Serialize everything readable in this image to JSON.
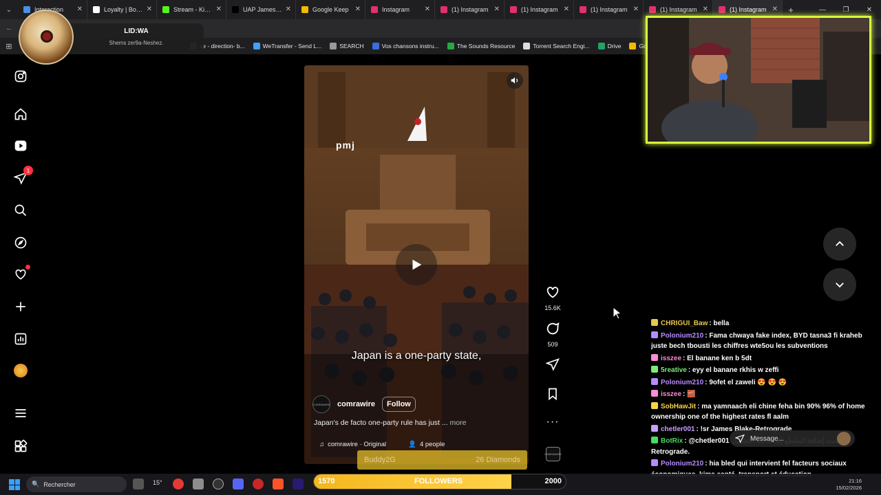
{
  "browser": {
    "tabs": [
      {
        "title": "Interaction",
        "color": "#4a90e2",
        "active": false
      },
      {
        "title": "Loyalty | BotRix",
        "color": "#ffffff",
        "active": false
      },
      {
        "title": "Stream - Kick D",
        "color": "#53fc18",
        "active": false
      },
      {
        "title": "UAP James on",
        "color": "#000000",
        "active": false
      },
      {
        "title": "Google Keep",
        "color": "#f6b900",
        "active": false
      },
      {
        "title": "Instagram",
        "color": "#e1306c",
        "active": false
      },
      {
        "title": "(1) Instagram",
        "color": "#e1306c",
        "active": false
      },
      {
        "title": "(1) Instagram",
        "color": "#e1306c",
        "active": false
      },
      {
        "title": "(1) Instagram",
        "color": "#e1306c",
        "active": false
      },
      {
        "title": "(1) Instagram",
        "color": "#e1306c",
        "active": false
      },
      {
        "title": "(1) Instagram",
        "color": "#e1306c",
        "active": true
      }
    ],
    "bookmarks": [
      {
        "label": "se - direction- b...",
        "color": "#777777"
      },
      {
        "label": "WeTransfer - Send L...",
        "color": "#409fff"
      },
      {
        "label": "SEARCH",
        "color": "#999999"
      },
      {
        "label": "Vos chansons instru...",
        "color": "#3b6edc"
      },
      {
        "label": "The Sounds Resource",
        "color": "#27a844"
      },
      {
        "label": "Torrent Search Engi...",
        "color": "#dddddd"
      },
      {
        "label": "Drive",
        "color": "#1fa463"
      },
      {
        "label": "Google Keep",
        "color": "#f6b900"
      }
    ]
  },
  "overlay": {
    "profile_name": "LID:WA",
    "profile_song": "Shems zer9a-Neshez."
  },
  "sidebar": {
    "notifications_badge": "1"
  },
  "reel": {
    "watermark": "pmj",
    "caption": "Japan is a one-party state,",
    "author": "comrawire",
    "author_avatar_text": "COMRAWIRE",
    "follow_label": "Follow",
    "description": "Japan's de facto one-party rule has just ...",
    "more_label": "more",
    "audio": "comrawire · Original",
    "people": "4 people",
    "likes": "15.6K",
    "comments": "509"
  },
  "chat": {
    "messages": [
      {
        "user": "CHRIGUI_Baw",
        "color": "#e6c84b",
        "text": ": bella"
      },
      {
        "user": "Polonium210",
        "color": "#b58cff",
        "text": ": Fama chwaya fake index, BYD tasna3 fi kraheb juste bech tbousti les chiffres wte5ou les subventions"
      },
      {
        "user": "isszee",
        "color": "#ff8ad8",
        "text": ": El banane ken b 5dt"
      },
      {
        "user": "5reative",
        "color": "#7bea7b",
        "text": ": eyy el banane rkhis w zeffi"
      },
      {
        "user": "Polonium210",
        "color": "#b58cff",
        "text": ": 9ofet el zaweli 😍 😍 😍"
      },
      {
        "user": "isszee",
        "color": "#ff8ad8",
        "text": ": 🧱"
      },
      {
        "user": "SobHawJit",
        "color": "#f5d547",
        "text": ": ma yamnaach eli chine feha bin 90% 96% of home ownership one of the highest rates fl aalm"
      },
      {
        "user": "chetler001",
        "color": "#c9a0ff",
        "text": ": !sr James Blake-Retrograde"
      },
      {
        "user": "BotRix",
        "color": "#4cd964",
        "text": ": @chetler001 تمت إضافة المقطع إلى قائمة التشغيل Retrograde."
      },
      {
        "user": "Polonium210",
        "color": "#b58cff",
        "text": ": hia bled qui intervient fel facteurs sociaux économiques, kima santé, transport et éducation"
      }
    ],
    "compose_placeholder": "Message..."
  },
  "followers": {
    "label": "FOLLOWERS",
    "current": "1570",
    "goal": "2000",
    "progress_fraction": 0.785
  },
  "buddy": {
    "name": "Buddy2G",
    "amount": "26 Diamonds"
  },
  "taskbar": {
    "search_placeholder": "Rechercher",
    "temperature": "15°",
    "time": "21:16",
    "date": "15/02/2026"
  }
}
